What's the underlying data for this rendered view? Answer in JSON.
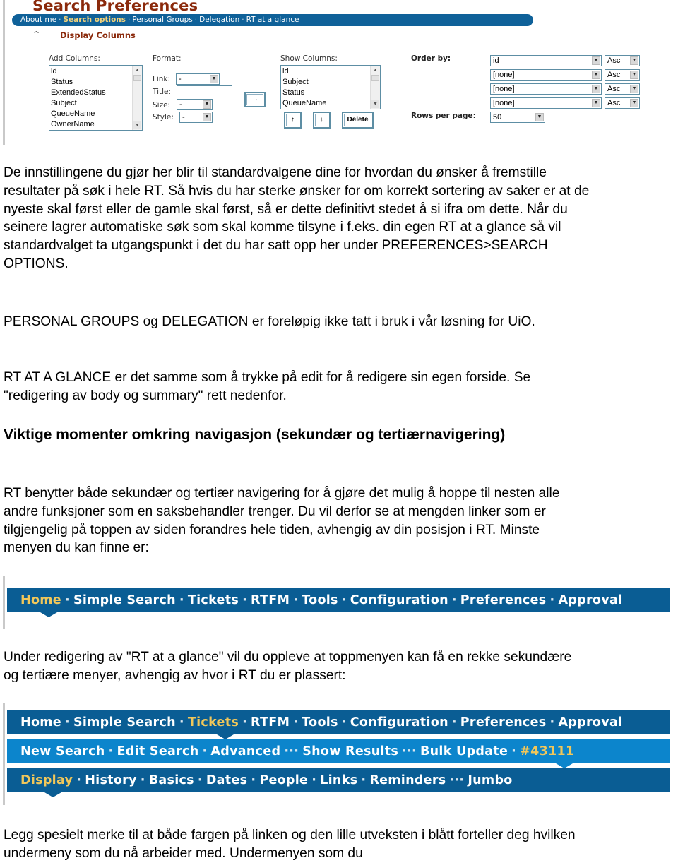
{
  "search_preferences": {
    "title": "Search Preferences",
    "tabs": [
      {
        "label": "About me",
        "active": false
      },
      {
        "label": "Search options",
        "active": true
      },
      {
        "label": "Personal Groups",
        "active": false
      },
      {
        "label": "Delegation",
        "active": false
      },
      {
        "label": "RT at a glance",
        "active": false
      }
    ],
    "tab_separator": "·",
    "section": {
      "caret": "^",
      "label": "Display Columns"
    },
    "add_columns": {
      "label": "Add Columns:",
      "options": [
        "id",
        "Status",
        "ExtendedStatus",
        "Subject",
        "QueueName",
        "OwnerName"
      ]
    },
    "format": {
      "label": "Format:",
      "link_label": "Link:",
      "link_value": "-",
      "title_label": "Title:",
      "title_value": "",
      "size_label": "Size:",
      "size_value": "-",
      "style_label": "Style:",
      "style_value": "-",
      "add_button": "→"
    },
    "show_columns": {
      "label": "Show Columns:",
      "options": [
        "id",
        "Subject",
        "Status",
        "QueueName"
      ],
      "up_button": "↑",
      "down_button": "↓",
      "delete_button": "Delete"
    },
    "order_by": {
      "label": "Order by:",
      "rows": [
        {
          "field": "id",
          "direction": "Asc"
        },
        {
          "field": "[none]",
          "direction": "Asc"
        },
        {
          "field": "[none]",
          "direction": "Asc"
        },
        {
          "field": "[none]",
          "direction": "Asc"
        }
      ]
    },
    "rows_per_page": {
      "label": "Rows per page:",
      "value": "50"
    },
    "colors": {
      "title": "#8b2a0c",
      "tabbar": "#0f6199",
      "active_tab": "#f2d27a"
    }
  },
  "paragraphs": {
    "p1": "De innstillingene du gjør her blir til standardvalgene dine for hvordan du ønsker å fremstille resultater på søk i hele RT. Så hvis du har sterke ønsker for om korrekt sortering av saker er at de nyeste skal først eller de gamle skal først, så er dette definitivt stedet å si ifra om dette. Når du seinere lagrer automatiske søk som skal komme tilsyne i f.eks. din egen RT at a glance så vil standardvalget ta utgangspunkt i det du har satt opp her under PREFERENCES>SEARCH OPTIONS.",
    "p2": "PERSONAL GROUPS og DELEGATION er foreløpig ikke tatt i bruk i vår løsning for UiO.",
    "p3": "RT AT A GLANCE er det samme som å trykke på edit for å redigere sin egen forside. Se \"redigering av body og summary\" rett nedenfor.",
    "heading": "Viktige momenter omkring navigasjon (sekundær og tertiærnavigering)",
    "p4": "RT benytter både sekundær og tertiær navigering for å gjøre det mulig å hoppe til nesten alle andre funksjoner som en saksbehandler trenger. Du vil derfor se at mengden linker som er tilgjengelig på toppen av siden forandres hele tiden, avhengig av din posisjon i RT. Minste menyen du kan finne er:",
    "p5": "Under redigering av \"RT at a glance\" vil du oppleve at toppmenyen kan få en rekke sekundære og tertiære menyer, avhengig av hvor i RT du er plassert:",
    "p6": "Legg spesielt merke til at både fargen på linken og den lille utveksten i blått forteller deg hvilken undermeny som du nå arbeider med. Undermenyen som du"
  },
  "menu_minimal": {
    "items": [
      {
        "label": "Home",
        "active": true,
        "sep": "·"
      },
      {
        "label": "Simple Search",
        "active": false,
        "sep": "·"
      },
      {
        "label": "Tickets",
        "active": false,
        "sep": "·"
      },
      {
        "label": "RTFM",
        "active": false,
        "sep": "·"
      },
      {
        "label": "Tools",
        "active": false,
        "sep": "·"
      },
      {
        "label": "Configuration",
        "active": false,
        "sep": "·"
      },
      {
        "label": "Preferences",
        "active": false,
        "sep": "·"
      },
      {
        "label": "Approval",
        "active": false,
        "sep": ""
      }
    ]
  },
  "menu_expanded": {
    "primary": [
      {
        "label": "Home",
        "active": false,
        "sep": "·"
      },
      {
        "label": "Simple Search",
        "active": false,
        "sep": "·"
      },
      {
        "label": "Tickets",
        "active": true,
        "sep": "·"
      },
      {
        "label": "RTFM",
        "active": false,
        "sep": "·"
      },
      {
        "label": "Tools",
        "active": false,
        "sep": "·"
      },
      {
        "label": "Configuration",
        "active": false,
        "sep": "·"
      },
      {
        "label": "Preferences",
        "active": false,
        "sep": "·"
      },
      {
        "label": "Approval",
        "active": false,
        "sep": ""
      }
    ],
    "secondary": [
      {
        "label": "New Search",
        "active": false,
        "sep": "·"
      },
      {
        "label": "Edit Search",
        "active": false,
        "sep": "·"
      },
      {
        "label": "Advanced",
        "active": false,
        "sep": "···"
      },
      {
        "label": "Show Results",
        "active": false,
        "sep": "···"
      },
      {
        "label": "Bulk Update",
        "active": false,
        "sep": "·"
      },
      {
        "label": "#43111",
        "active": true,
        "sep": ""
      }
    ],
    "tertiary": [
      {
        "label": "Display",
        "active": true,
        "sep": "·"
      },
      {
        "label": "History",
        "active": false,
        "sep": "·"
      },
      {
        "label": "Basics",
        "active": false,
        "sep": "·"
      },
      {
        "label": "Dates",
        "active": false,
        "sep": "·"
      },
      {
        "label": "People",
        "active": false,
        "sep": "·"
      },
      {
        "label": "Links",
        "active": false,
        "sep": "·"
      },
      {
        "label": "Reminders",
        "active": false,
        "sep": "···"
      },
      {
        "label": "Jumbo",
        "active": false,
        "sep": ""
      }
    ],
    "colors": {
      "dark": "#0a5d94",
      "light": "#0c85cc",
      "active_link": "#f1c75a"
    }
  }
}
